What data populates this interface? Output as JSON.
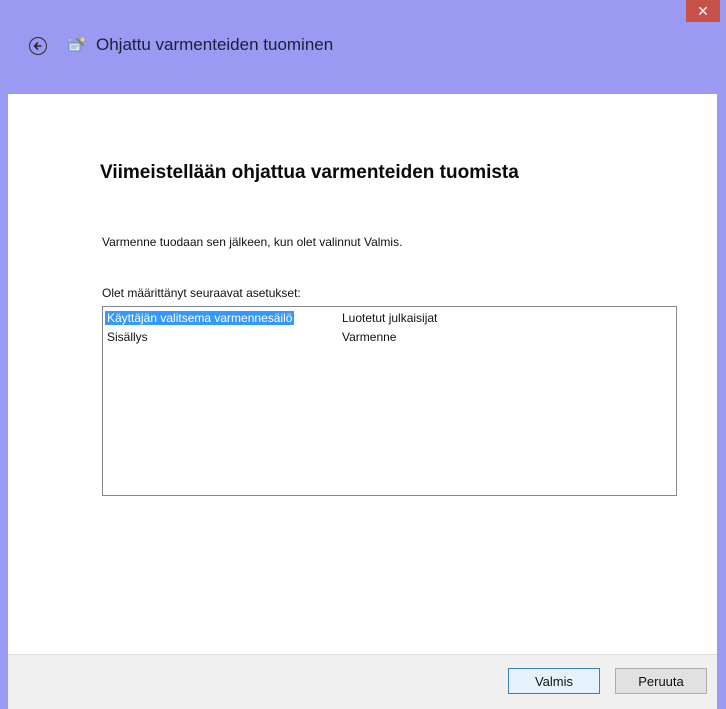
{
  "window": {
    "close_symbol": "✕",
    "colors": {
      "frame": "#9a9af2",
      "close": "#c7504a",
      "selection": "#3399ff"
    }
  },
  "header": {
    "title": "Ohjattu varmenteiden tuominen",
    "back_icon": "back-arrow-icon",
    "wizard_icon": "certificate-wizard-icon"
  },
  "main": {
    "title": "Viimeistellään ohjattua varmenteiden tuomista",
    "description": "Varmenne tuodaan sen jälkeen, kun olet valinnut Valmis.",
    "list_label": "Olet määrittänyt seuraavat asetukset:",
    "settings": [
      {
        "key": "Käyttäjän valitsema varmennesäilö",
        "value": "Luotetut julkaisijat",
        "selected": true
      },
      {
        "key": "Sisällys",
        "value": "Varmenne",
        "selected": false
      }
    ]
  },
  "footer": {
    "finish_label": "Valmis",
    "cancel_label": "Peruuta"
  }
}
